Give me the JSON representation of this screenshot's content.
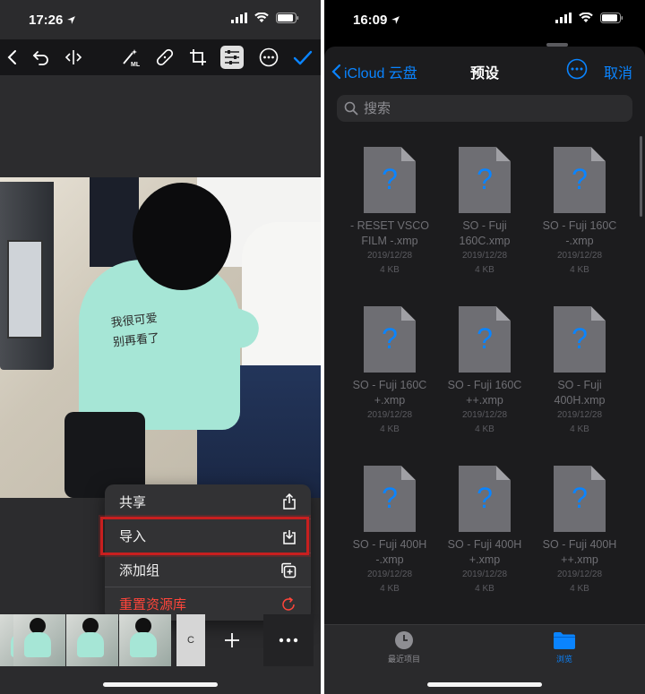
{
  "left": {
    "status": {
      "time": "17:26"
    },
    "toolbar": {
      "tools": [
        "back-chevron",
        "undo",
        "compare",
        "ml-wand",
        "healing-bandage",
        "crop",
        "adjust-sliders",
        "more-circle",
        "done-check"
      ]
    },
    "photo": {
      "shirt_text_line1": "我很可爱",
      "shirt_text_line2": "别再看了"
    },
    "menu": {
      "share": "共享",
      "import": "导入",
      "add_group": "添加组",
      "reset_library": "重置资源库"
    },
    "filmstrip": {
      "preset_c": "C"
    },
    "colors": {
      "highlight": "#c81f1f",
      "destructive": "#ff453a",
      "accent": "#0a84ff"
    }
  },
  "right": {
    "status": {
      "time": "16:09"
    },
    "nav": {
      "back": "iCloud 云盘",
      "title": "预设",
      "cancel": "取消"
    },
    "search": {
      "placeholder": "搜索"
    },
    "files": [
      {
        "name": "- RESET VSCO\nFILM -.xmp",
        "date": "2019/12/28",
        "size": "4 KB"
      },
      {
        "name": "SO - Fuji\n160C.xmp",
        "date": "2019/12/28",
        "size": "4 KB"
      },
      {
        "name": "SO - Fuji 160C\n-.xmp",
        "date": "2019/12/28",
        "size": "4 KB"
      },
      {
        "name": "SO - Fuji 160C\n+.xmp",
        "date": "2019/12/28",
        "size": "4 KB"
      },
      {
        "name": "SO - Fuji 160C\n++.xmp",
        "date": "2019/12/28",
        "size": "4 KB"
      },
      {
        "name": "SO - Fuji\n400H.xmp",
        "date": "2019/12/28",
        "size": "4 KB"
      },
      {
        "name": "SO - Fuji 400H\n-.xmp",
        "date": "2019/12/28",
        "size": "4 KB"
      },
      {
        "name": "SO - Fuji 400H\n+.xmp",
        "date": "2019/12/28",
        "size": "4 KB"
      },
      {
        "name": "SO - Fuji 400H\n++.xmp",
        "date": "2019/12/28",
        "size": "4 KB"
      }
    ],
    "tabs": {
      "recent": "最近项目",
      "browse": "浏览"
    }
  }
}
